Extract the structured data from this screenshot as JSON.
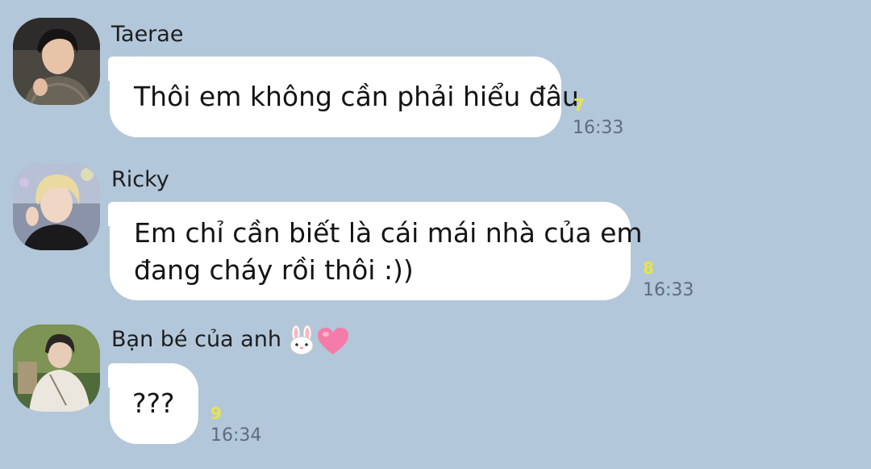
{
  "messages": [
    {
      "sender": "Taerae",
      "text_lines": [
        "Thôi em không cần phải hiểu đâu"
      ],
      "read_count": "7",
      "time": "16:33",
      "avatar_icon": "profile-photo-icon"
    },
    {
      "sender": "Ricky",
      "text_lines": [
        "Em chỉ cần biết là cái mái nhà của em",
        "đang cháy rồi thôi :))"
      ],
      "read_count": "8",
      "time": "16:33",
      "avatar_icon": "profile-photo-icon"
    },
    {
      "sender": "Bạn bé của anh",
      "sender_emojis": [
        "rabbit-face-icon",
        "pink-heart-icon"
      ],
      "text_lines": [
        "???"
      ],
      "read_count": "9",
      "time": "16:34",
      "avatar_icon": "profile-photo-icon"
    }
  ],
  "colors": {
    "background": "#b2c7da",
    "bubble": "#ffffff",
    "read_count": "#e8e44b",
    "time": "#5d6d7c"
  }
}
